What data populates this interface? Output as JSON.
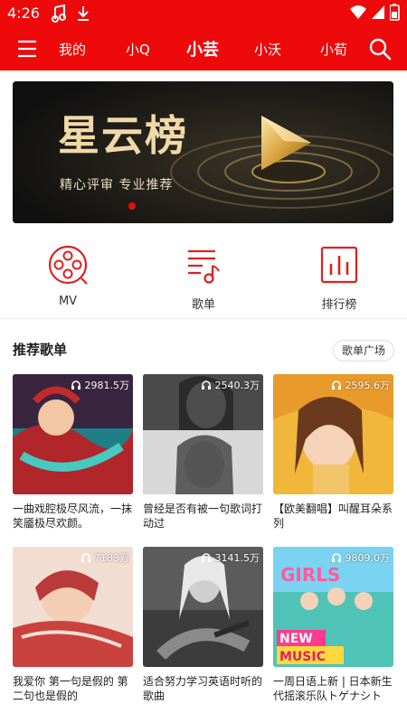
{
  "status_bar": {
    "time": "4:26",
    "icons": [
      "music-note-icon",
      "download-icon",
      "wifi-icon",
      "signal-icon",
      "battery-icon"
    ]
  },
  "top_nav": {
    "menu_icon": "menu-icon",
    "tabs": [
      {
        "label": "我的",
        "active": false
      },
      {
        "label": "小Q",
        "active": false
      },
      {
        "label": "小芸",
        "active": true
      },
      {
        "label": "小沃",
        "active": false
      },
      {
        "label": "小荀",
        "active": false
      }
    ],
    "search_icon": "search-icon"
  },
  "banner": {
    "title": "星云榜",
    "subtitle": "精心评审 专业推荐",
    "active_dot": 1
  },
  "quick_links": [
    {
      "label": "MV",
      "icon": "film-reel-icon"
    },
    {
      "label": "歌单",
      "icon": "music-list-icon"
    },
    {
      "label": "排行榜",
      "icon": "chart-icon"
    }
  ],
  "recommend": {
    "title": "推荐歌单",
    "more_button": "歌单广场",
    "playlists": [
      {
        "plays": "2981.5万",
        "caption": "一曲戏腔极尽风流，一抹笑靥极尽欢颜。"
      },
      {
        "plays": "2540.3万",
        "caption": "曾经是否有被一句歌词打动过"
      },
      {
        "plays": "2595.6万",
        "caption": "【欧美翻唱】叫醒耳朵系列"
      },
      {
        "plays": "7183万",
        "caption": "我爱你 第一句是假的 第二句也是假的"
      },
      {
        "plays": "3141.5万",
        "caption": "适合努力学习英语时听的歌曲"
      },
      {
        "plays": "9809.0万",
        "caption": "一周日语上新 | 日本新生代摇滚乐队トゲナシトゲ..."
      }
    ]
  },
  "colors": {
    "brand_red": "#ee0a0a"
  }
}
